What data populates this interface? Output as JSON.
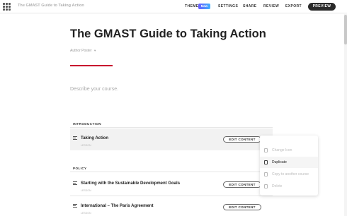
{
  "header": {
    "app_title": "The GMAST Guide to Taking Action",
    "nav": {
      "theme": "THEME",
      "new_badge": "New",
      "settings": "SETTINGS",
      "share": "SHARE",
      "review": "REVIEW",
      "export": "EXPORT",
      "preview": "PREVIEW"
    }
  },
  "course": {
    "title": "The GMAST Guide to Taking Action",
    "author": "Author Poster",
    "author_caret": "▾",
    "description_placeholder": "Describe your course.",
    "accent_color": "#c8102e"
  },
  "sections": [
    {
      "label": "INTRODUCTION",
      "lessons": [
        {
          "title": "Taking Action",
          "meta": "LESSON",
          "edit_label": "EDIT CONTENT",
          "more_label": "•••"
        }
      ]
    },
    {
      "label": "POLICY",
      "lessons": [
        {
          "title": "Starting with the Sustainable Development Goals",
          "meta": "LESSON",
          "edit_label": "EDIT CONTENT"
        },
        {
          "title": "International – The Paris Agreement",
          "meta": "LESSON",
          "edit_label": "EDIT CONTENT"
        }
      ]
    }
  ],
  "context_menu": {
    "items": [
      {
        "label": "Change Icon",
        "icon": "edit-icon",
        "enabled": false
      },
      {
        "label": "Duplicate",
        "icon": "duplicate-icon",
        "enabled": true
      },
      {
        "label": "Copy to another course",
        "icon": "copy-icon",
        "enabled": false
      },
      {
        "label": "Delete",
        "icon": "trash-icon",
        "enabled": false
      }
    ]
  }
}
